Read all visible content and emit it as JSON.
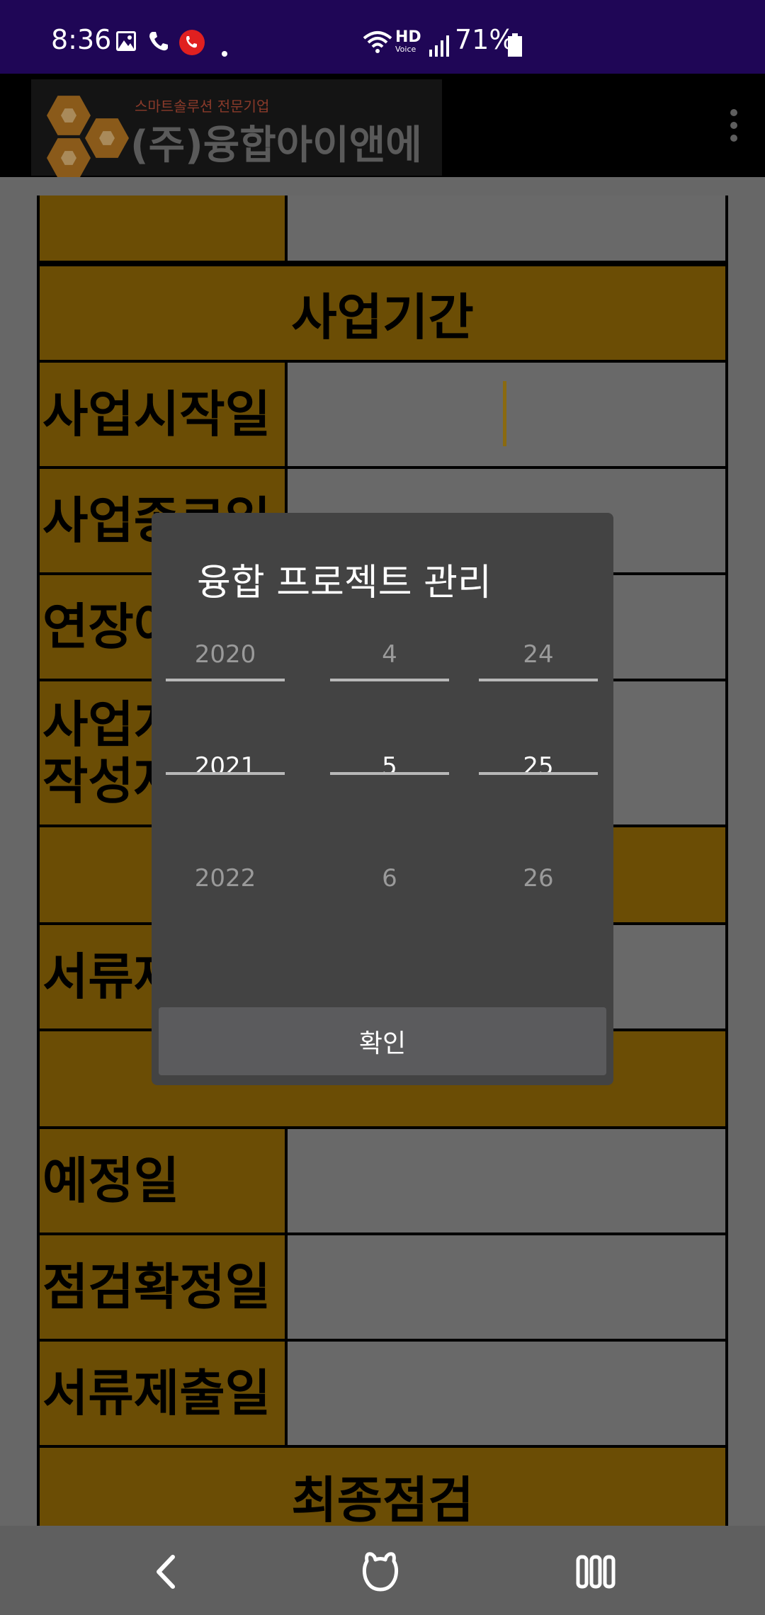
{
  "status_bar": {
    "time": "8:36",
    "battery": "71%",
    "icons": [
      "gallery-icon",
      "phone-icon",
      "call-recording-icon",
      "dot-icon",
      "wifi-icon",
      "hd-voice-icon",
      "signal-icon",
      "battery-icon"
    ],
    "hd_label": "HD",
    "voice_label": "Voice"
  },
  "app_bar": {
    "logo_subtitle": "스마트솔루션 전문기업",
    "logo_title": "(주)융합아이앤에스",
    "menu_icon": "more-vert-icon"
  },
  "form": {
    "section_business_period": "사업기간",
    "rows": [
      {
        "label": "사업시작일"
      },
      {
        "label": "사업종료일"
      },
      {
        "label": "연장여부"
      },
      {
        "label": "사업계획서 작성자"
      },
      {
        "label": "서류제출일"
      },
      {
        "label": "예정일"
      },
      {
        "label": "점검확정일"
      },
      {
        "label": "서류제출일"
      }
    ],
    "section_final_check": "최종점검"
  },
  "dialog": {
    "title": "융합 프로젝트 관리",
    "year": {
      "prev": "2020",
      "current": "2021",
      "next": "2022"
    },
    "month": {
      "prev": "4",
      "current": "5",
      "next": "6"
    },
    "day": {
      "prev": "24",
      "current": "25",
      "next": "26"
    },
    "confirm_label": "확인"
  },
  "nav_bar": {
    "icons": [
      "back-icon",
      "home-icon",
      "recents-icon"
    ]
  },
  "colors": {
    "status_bar": "#1f0656",
    "label_cell": "#6b4d05",
    "content_bg": "#676767",
    "dialog_bg": "#434343",
    "confirm_bg": "#5b5b5d"
  }
}
